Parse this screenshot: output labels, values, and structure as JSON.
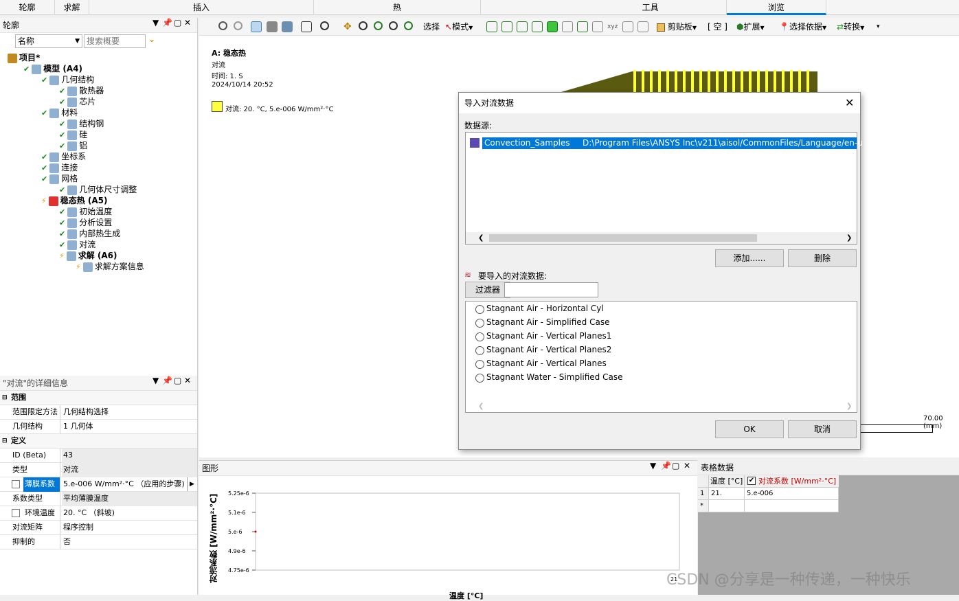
{
  "ribbon": {
    "tabs": [
      "轮廓",
      "求解",
      "插入",
      "热",
      "工具",
      "浏览"
    ]
  },
  "outline": {
    "title": "轮廓",
    "search_name": "名称",
    "search_placeholder": "搜索概要",
    "tree": [
      {
        "label": "项目*",
        "bold": true
      },
      {
        "label": "模型 (A4)",
        "bold": true
      },
      {
        "label": "几何结构"
      },
      {
        "label": "散热器"
      },
      {
        "label": "芯片"
      },
      {
        "label": "材料"
      },
      {
        "label": "结构钢"
      },
      {
        "label": "硅"
      },
      {
        "label": "铝"
      },
      {
        "label": "坐标系"
      },
      {
        "label": "连接"
      },
      {
        "label": "网格"
      },
      {
        "label": "几何体尺寸调整"
      },
      {
        "label": "稳态热 (A5)",
        "bold": true
      },
      {
        "label": "初始温度"
      },
      {
        "label": "分析设置"
      },
      {
        "label": "内部热生成"
      },
      {
        "label": "对流"
      },
      {
        "label": "求解 (A6)",
        "bold": true
      },
      {
        "label": "求解方案信息"
      }
    ]
  },
  "details": {
    "title": "\"对流\"的详细信息",
    "rows": [
      {
        "section": "范围"
      },
      {
        "k": "范围限定方法",
        "v": "几何结构选择"
      },
      {
        "k": "几何结构",
        "v": "1 几何体"
      },
      {
        "section": "定义"
      },
      {
        "k": "ID (Beta)",
        "v": "43"
      },
      {
        "k": "类型",
        "v": "对流"
      },
      {
        "k": "薄膜系数",
        "v": "5.e-006 W/mm²·°C （应用的步骤)"
      },
      {
        "k": "系数类型",
        "v": "平均薄膜温度"
      },
      {
        "k": "环境温度",
        "v": "20. °C （斜坡)"
      },
      {
        "k": "对流矩阵",
        "v": "程序控制"
      },
      {
        "k": "抑制的",
        "v": "否"
      }
    ]
  },
  "toolbar": {
    "select": "选择",
    "mode": "模式",
    "clipboard": "剪贴板",
    "empty": "[ 空 ]",
    "extend": "扩展",
    "select_by": "选择依据",
    "convert": "转换"
  },
  "viewport": {
    "title": "A: 稳态热",
    "subtitle": "对流",
    "time": "时间: 1. S",
    "date": "2024/10/14 20:52",
    "legend": "对流: 20. °C, 5.e-006 W/mm²·°C",
    "scale": "70.00 (mm)"
  },
  "dialog": {
    "title": "导入对流数据",
    "source_label": "数据源:",
    "source_name": "Convection_Samples",
    "source_path": "D:\\Program Files\\ANSYS Inc\\v211\\aisol/CommonFiles/Language/en-u",
    "add": "添加......",
    "delete": "删除",
    "import_label": "要导入的对流数据:",
    "filter": "过滤器",
    "options": [
      "Stagnant Air - Horizontal Cyl",
      "Stagnant Air - Simplified Case",
      "Stagnant Air - Vertical Planes1",
      "Stagnant Air - Vertical Planes2",
      "Stagnant Air - Vertical Planes",
      "Stagnant Water - Simplified Case"
    ],
    "ok": "OK",
    "cancel": "取消"
  },
  "graph": {
    "title": "图形",
    "ylabel": "对流系数 [W/mm²·°C]",
    "xlabel": "温度 [°C]",
    "yticks": [
      "5.25e-6",
      "5.1e-6",
      "5.e-6",
      "4.9e-6",
      "4.75e-6"
    ],
    "xtick": "21"
  },
  "table": {
    "title": "表格数据",
    "headers": [
      "温度 [°C]",
      "对流系数 [W/mm²·°C]"
    ],
    "rows": [
      [
        "1",
        "21.",
        "5.e-006"
      ],
      [
        "*",
        "",
        ""
      ]
    ]
  },
  "watermark": "CSDN @分享是一种传递，一种快乐",
  "colors": {
    "selection": "#0078d7",
    "yellow": "#ffff40",
    "heatsink": "#8a8a1a"
  }
}
